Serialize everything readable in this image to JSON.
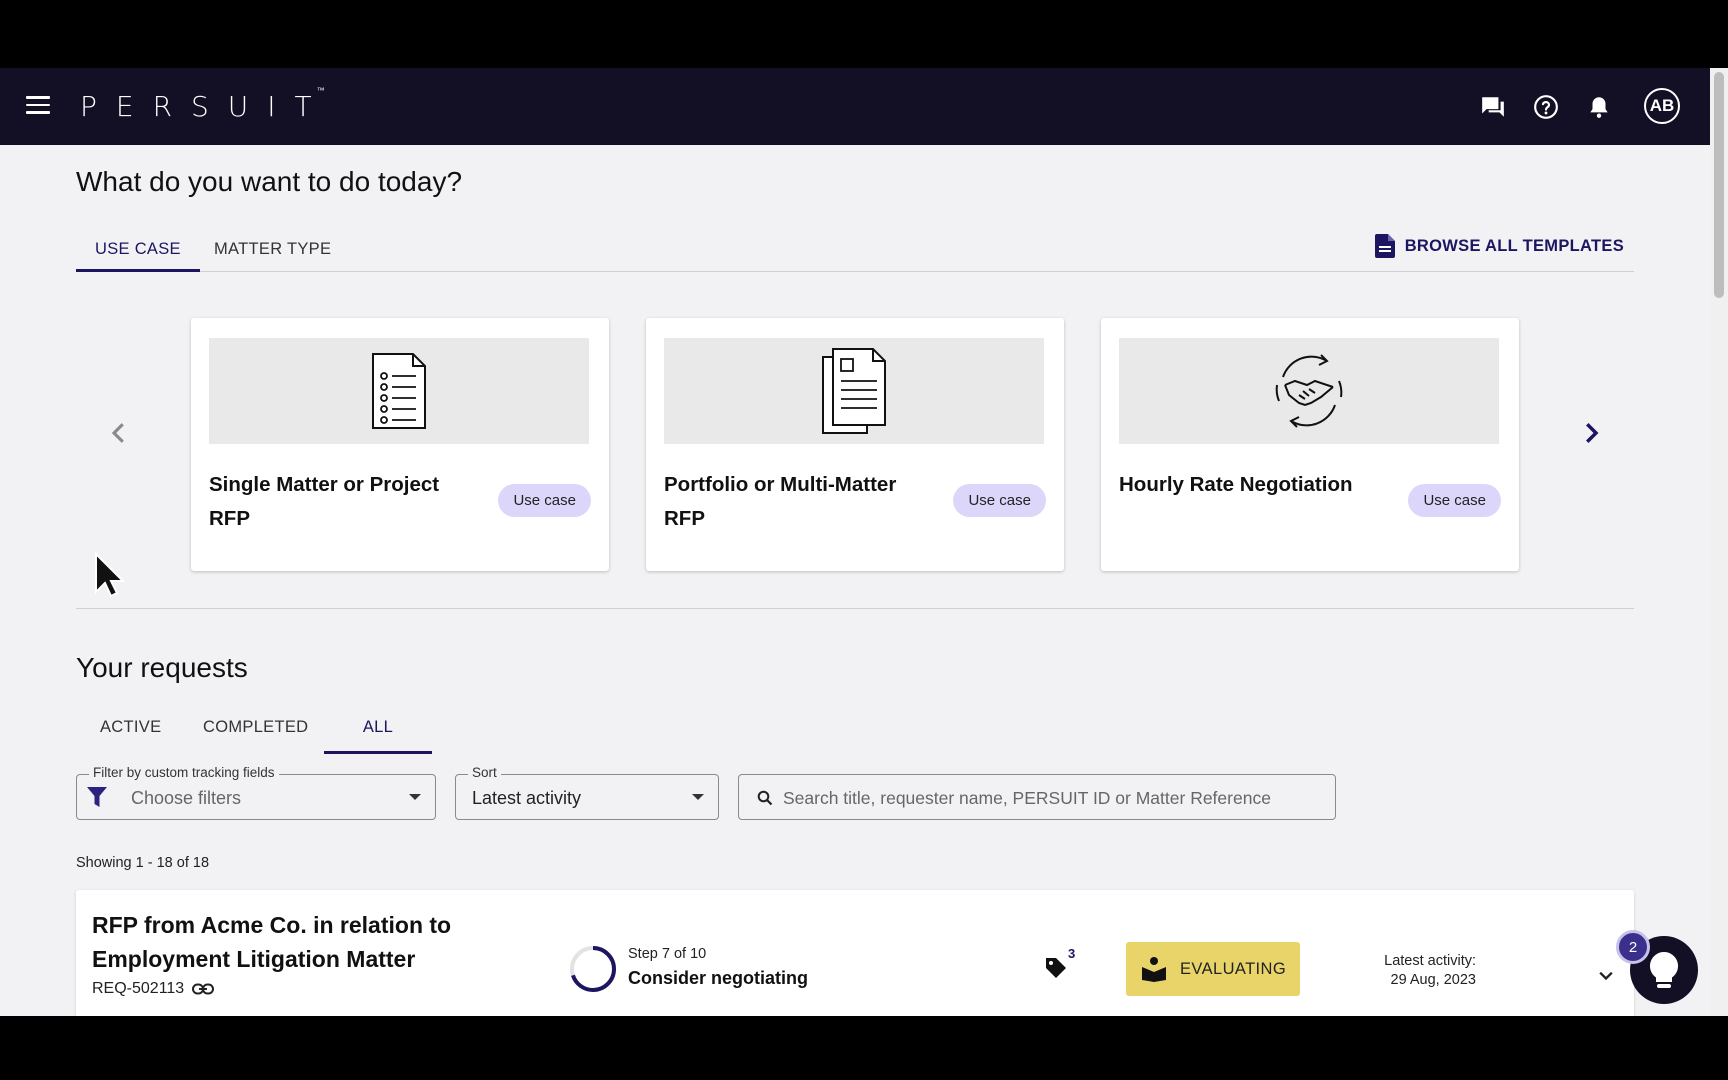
{
  "app": {
    "logo": "PERSUIT",
    "logo_mark": "™",
    "user_initials": "AB"
  },
  "hero": {
    "title": "What do you want to do today?",
    "tabs": [
      {
        "label": "USE CASE",
        "active": true
      },
      {
        "label": "MATTER TYPE",
        "active": false
      }
    ],
    "browse_label": "BROWSE ALL TEMPLATES"
  },
  "templates": [
    {
      "title": "Single Matter or Project RFP",
      "badge": "Use case",
      "icon": "checklist-document-icon"
    },
    {
      "title": "Portfolio or Multi-Matter RFP",
      "badge": "Use case",
      "icon": "stacked-documents-icon"
    },
    {
      "title": "Hourly Rate Negotiation",
      "badge": "Use case",
      "icon": "handshake-cycle-icon"
    }
  ],
  "requests": {
    "title": "Your requests",
    "tabs": [
      {
        "label": "ACTIVE",
        "active": false
      },
      {
        "label": "COMPLETED",
        "active": false
      },
      {
        "label": "ALL",
        "active": true
      }
    ],
    "filter": {
      "label": "Filter by custom tracking fields",
      "placeholder": "Choose filters"
    },
    "sort": {
      "label": "Sort",
      "value": "Latest activity"
    },
    "search": {
      "placeholder": "Search title, requester name, PERSUIT ID or Matter Reference",
      "value": ""
    },
    "showing": "Showing 1 - 18 of 18",
    "items": [
      {
        "title": "RFP from Acme Co. in relation to Employment Litigation Matter",
        "id": "REQ-502113",
        "step_label": "Step 7 of 10",
        "step_name": "Consider negotiating",
        "step_progress": 0.7,
        "tag_count": "3",
        "status": "EVALUATING",
        "latest_label": "Latest activity:",
        "latest_date": "29 Aug, 2023"
      }
    ]
  },
  "help": {
    "badge_count": "2"
  },
  "colors": {
    "brand_dark": "#130f24",
    "accent": "#1c1660",
    "pill": "#ddd6fb",
    "status_evaluating": "#e9d46a"
  }
}
